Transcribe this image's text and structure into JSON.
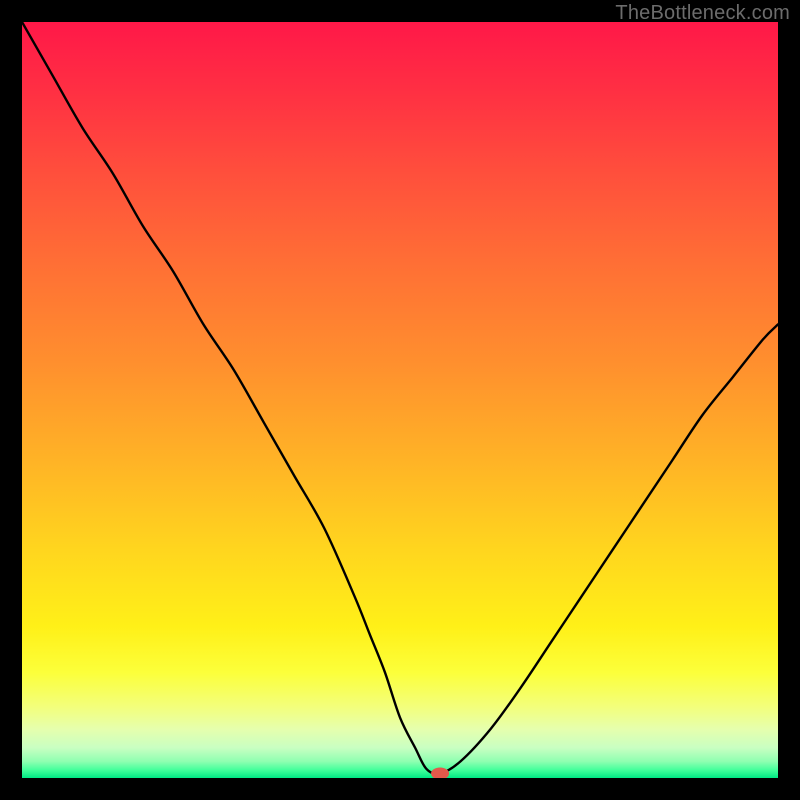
{
  "watermark": "TheBottleneck.com",
  "chart_data": {
    "type": "line",
    "title": "",
    "xlabel": "",
    "ylabel": "",
    "xlim": [
      0,
      100
    ],
    "ylim": [
      0,
      100
    ],
    "grid": false,
    "legend": false,
    "series": [
      {
        "name": "curve",
        "x": [
          0,
          4,
          8,
          12,
          16,
          20,
          24,
          28,
          32,
          36,
          40,
          44,
          46,
          48,
          50,
          52,
          53.5,
          55.3,
          58,
          62,
          66,
          70,
          74,
          78,
          82,
          86,
          90,
          94,
          98,
          100
        ],
        "values": [
          100,
          93,
          86,
          80,
          73,
          67,
          60,
          54,
          47,
          40,
          33,
          24,
          19,
          14,
          8,
          4,
          1.2,
          0.6,
          2.2,
          6.5,
          12,
          18,
          24,
          30,
          36,
          42,
          48,
          53,
          58,
          60
        ]
      }
    ],
    "marker": {
      "x": 55.3,
      "y": 0.6,
      "color": "#e2594b",
      "rx": 9,
      "ry": 6
    },
    "gradient_stops": [
      {
        "offset": 0.0,
        "color": "#ff1848"
      },
      {
        "offset": 0.09,
        "color": "#ff2f43"
      },
      {
        "offset": 0.2,
        "color": "#ff4f3c"
      },
      {
        "offset": 0.32,
        "color": "#ff6f35"
      },
      {
        "offset": 0.45,
        "color": "#ff8f2e"
      },
      {
        "offset": 0.58,
        "color": "#ffb326"
      },
      {
        "offset": 0.7,
        "color": "#ffd61e"
      },
      {
        "offset": 0.8,
        "color": "#fff018"
      },
      {
        "offset": 0.86,
        "color": "#fcff3a"
      },
      {
        "offset": 0.905,
        "color": "#f3ff7a"
      },
      {
        "offset": 0.935,
        "color": "#e6ffad"
      },
      {
        "offset": 0.96,
        "color": "#c9ffc2"
      },
      {
        "offset": 0.978,
        "color": "#8fffb1"
      },
      {
        "offset": 0.99,
        "color": "#3fff9a"
      },
      {
        "offset": 1.0,
        "color": "#00e884"
      }
    ]
  }
}
